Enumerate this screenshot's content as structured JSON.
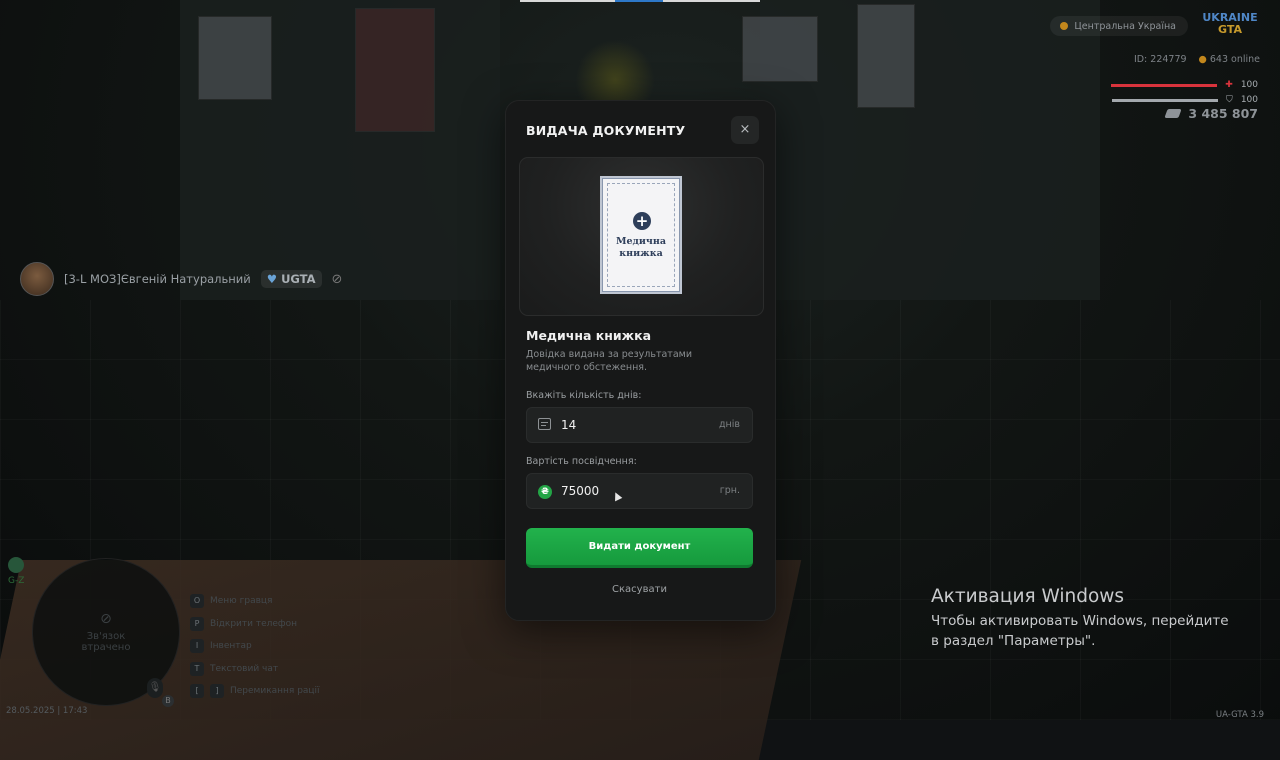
{
  "hud": {
    "region": "Центральна Україна",
    "logo_line1": "UKRAINE",
    "logo_line2": "GTA",
    "player_id": "ID: 224779",
    "online": "643 online",
    "health": "100",
    "armor": "100",
    "money": "3 485 807",
    "health_color": "#d8333c",
    "armor_color": "#a3a8ad"
  },
  "player": {
    "name": "[3-L МОЗ]Євгеній Натуральний",
    "org": "UGTA"
  },
  "minimap": {
    "no_signal_line1": "Зв'язок",
    "no_signal_line2": "втрачено",
    "zone": "G-Z",
    "datetime": "28.05.2025 | 17:43",
    "mic_key": "B"
  },
  "hints": [
    {
      "key": "O",
      "label": "Меню гравця"
    },
    {
      "key": "P",
      "label": "Відкрити телефон"
    },
    {
      "key": "I",
      "label": "Інвентар"
    },
    {
      "key": "T",
      "label": "Текстовий чат"
    },
    {
      "key": "[",
      "key2": "]",
      "label": "Перемикання рації"
    }
  ],
  "modal": {
    "title": "ВИДАЧА ДОКУМЕНТУ",
    "close_label": "×",
    "doc_card_title": "Медична книжка",
    "doc_name": "Медична книжка",
    "doc_description": "Довідка видана за результатами медичного обстеження.",
    "days_label": "Вкажіть кількість днів:",
    "days_value": "14",
    "days_unit": "днів",
    "price_label": "Вартість посвідчення:",
    "price_value": "75000",
    "price_unit": "грн.",
    "currency_symbol": "₴",
    "submit_label": "Видати документ",
    "cancel_label": "Скасувати",
    "accent_color": "#1fab48"
  },
  "windows_activation": {
    "title": "Активация Windows",
    "text": "Чтобы активировать Windows, перейдите в раздел \"Параметры\"."
  },
  "version": "UA-GTA 3.9"
}
